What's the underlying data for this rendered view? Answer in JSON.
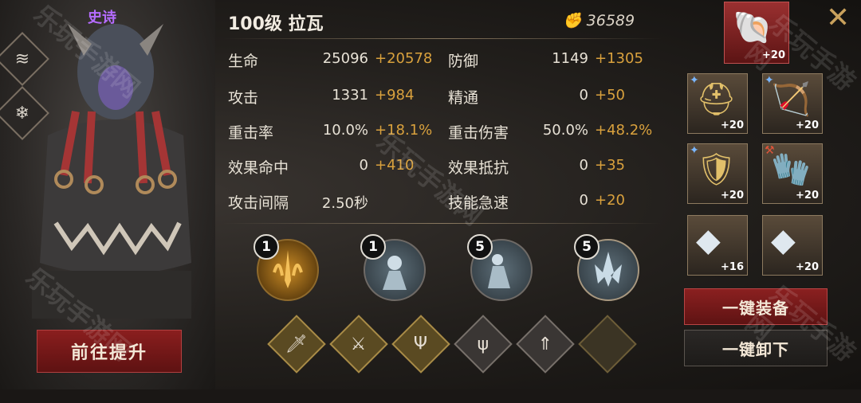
{
  "character": {
    "rarity": "史诗",
    "level_name": "100级  拉瓦",
    "power": "36589",
    "goto_upgrade": "前往提升"
  },
  "stats": [
    {
      "label": "生命",
      "base": "25096",
      "bonus": "+20578"
    },
    {
      "label": "防御",
      "base": "1149",
      "bonus": "+1305"
    },
    {
      "label": "攻击",
      "base": "1331",
      "bonus": "+984"
    },
    {
      "label": "精通",
      "base": "0",
      "bonus": "+50"
    },
    {
      "label": "重击率",
      "base": "10.0%",
      "bonus": "+18.1%"
    },
    {
      "label": "重击伤害",
      "base": "50.0%",
      "bonus": "+48.2%"
    },
    {
      "label": "效果命中",
      "base": "0",
      "bonus": "+410"
    },
    {
      "label": "效果抵抗",
      "base": "0",
      "bonus": "+35"
    },
    {
      "label": "攻击间隔",
      "base": "2.50秒",
      "bonus": ""
    },
    {
      "label": "技能急速",
      "base": "0",
      "bonus": "+20"
    }
  ],
  "skills": [
    {
      "level": "1",
      "icon": "flame-sword-icon"
    },
    {
      "level": "1",
      "icon": "warrior-icon"
    },
    {
      "level": "5",
      "icon": "dancer-icon"
    },
    {
      "level": "5",
      "icon": "crystal-burst-icon"
    }
  ],
  "equipment": {
    "top": {
      "level": "+20"
    },
    "slots": [
      {
        "level": "+20"
      },
      {
        "level": "+20"
      },
      {
        "level": "+20"
      },
      {
        "level": "+20"
      },
      {
        "level": "+16"
      },
      {
        "level": "+20"
      }
    ]
  },
  "actions": {
    "equip_all": "一键装备",
    "unequip_all": "一键卸下"
  },
  "watermark": "乐玩手游网",
  "colors": {
    "accent_red": "#8b2020",
    "bonus_gold": "#d9a13d",
    "rarity_purple": "#b56cff"
  }
}
